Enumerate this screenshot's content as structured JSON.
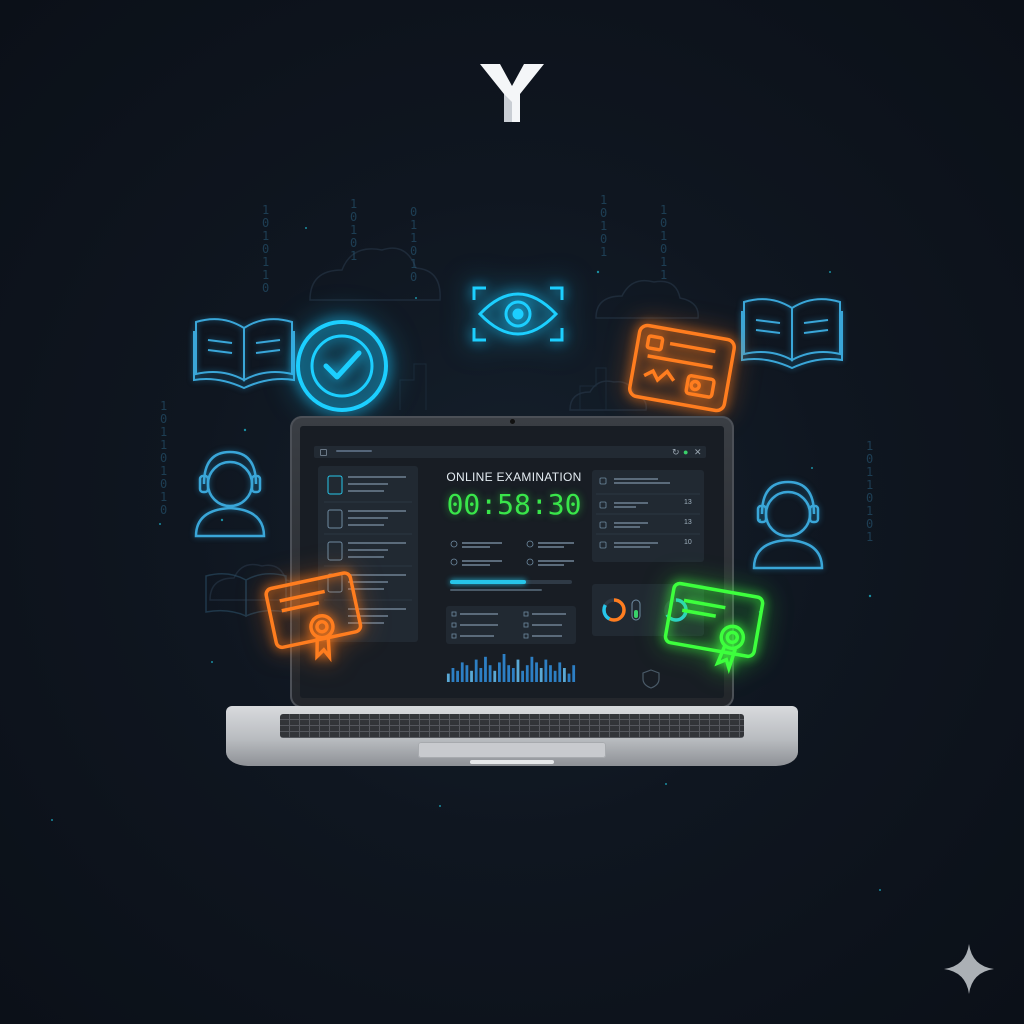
{
  "brand": {
    "logo_letter": "Y"
  },
  "colors": {
    "background": "#0f1620",
    "accent_cyan": "#19c8ff",
    "accent_orange": "#ff7a1a",
    "accent_green": "#3dff3d",
    "timer_green": "#39e64a",
    "screen_bg": "#181d24",
    "panel_bg": "#212932"
  },
  "icons": {
    "top_logo": "y-logo-icon",
    "checkmark": "check-circle-icon",
    "eye": "eye-scan-icon",
    "book_left": "open-book-icon",
    "book_right": "open-book-icon",
    "id_card": "id-card-icon",
    "user_headset_left": "user-headset-icon",
    "user_headset_right": "user-headset-icon",
    "certificate_orange": "certificate-icon",
    "certificate_green": "certificate-icon",
    "sparkle": "sparkle-icon",
    "close": "close-icon",
    "refresh": "refresh-icon",
    "shield": "shield-icon"
  },
  "exam": {
    "title": "ONLINE EXAMINATION",
    "timer": "00:58:30",
    "progress_fraction": 0.62
  },
  "right_list": {
    "numbers": [
      "13",
      "13",
      "10"
    ]
  },
  "bar_chart": {
    "values": [
      3,
      5,
      4,
      7,
      6,
      4,
      8,
      5,
      9,
      6,
      4,
      7,
      10,
      6,
      5,
      8,
      4,
      6,
      9,
      7,
      5,
      8,
      6,
      4,
      7,
      5,
      3,
      6
    ]
  }
}
